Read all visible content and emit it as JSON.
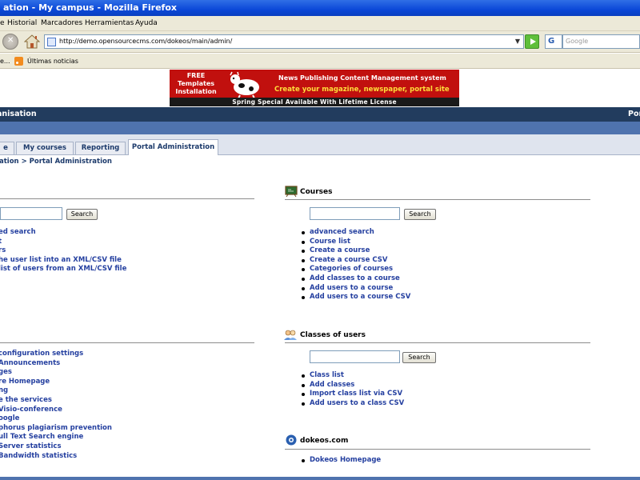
{
  "window": {
    "title": "ation - My campus - Mozilla Firefox"
  },
  "menu": {
    "items": [
      "Historial",
      "Marcadores",
      "Herramientas",
      "Ayuda"
    ],
    "leading": "e"
  },
  "navbar": {
    "url": "http://demo.opensourcecms.com/dokeos/main/admin/",
    "search_placeholder": "Google",
    "search_engine": "G"
  },
  "bookmarks": {
    "leading": "e...",
    "news_label": "Últimas noticias"
  },
  "banner": {
    "free_lines": [
      "FREE",
      "Templates",
      "Installation"
    ],
    "line1": "News Publishing Content Management system",
    "line2": "Create your magazine, newspaper, portal site",
    "strip": "Spring Special Available With Lifetime License"
  },
  "org_bar": {
    "name": "anisation",
    "right": "Por"
  },
  "tabs": [
    {
      "label": "e"
    },
    {
      "label": "My courses"
    },
    {
      "label": "Reporting"
    },
    {
      "label": "Portal Administration"
    }
  ],
  "breadcrumb": "ation > Portal Administration",
  "users_section": {
    "search_button": "Search",
    "links": [
      "ed search",
      "t",
      "rs",
      "he user list into an XML/CSV file",
      "list of users from an XML/CSV file"
    ]
  },
  "platform_section": {
    "links": [
      "configuration settings",
      "Announcements",
      "ges",
      "re Homepage",
      "ng",
      "e the services",
      "Visio-conference",
      "oogle",
      "phorus plagiarism prevention",
      "ull Text Search engine",
      "Server statistics",
      "Bandwidth statistics"
    ]
  },
  "courses_section": {
    "title": "Courses",
    "search_button": "Search",
    "links": [
      "advanced search",
      "Course list",
      "Create a course",
      "Create a course CSV",
      "Categories of courses",
      "Add classes to a course",
      "Add users to a course",
      "Add users to a course CSV"
    ]
  },
  "classes_section": {
    "title": "Classes of users",
    "search_button": "Search",
    "links": [
      "Class list",
      "Add classes",
      "Import class list via CSV",
      "Add users to a class CSV"
    ]
  },
  "dokeos_section": {
    "title": "dokeos.com",
    "links": [
      "Dokeos Homepage"
    ]
  },
  "colors": {
    "titlebar": "#0b48d8",
    "org_bar": "#223c5e",
    "sub_bar": "#4f73ae",
    "link": "#2540a0",
    "banner_red": "#c1100e"
  }
}
